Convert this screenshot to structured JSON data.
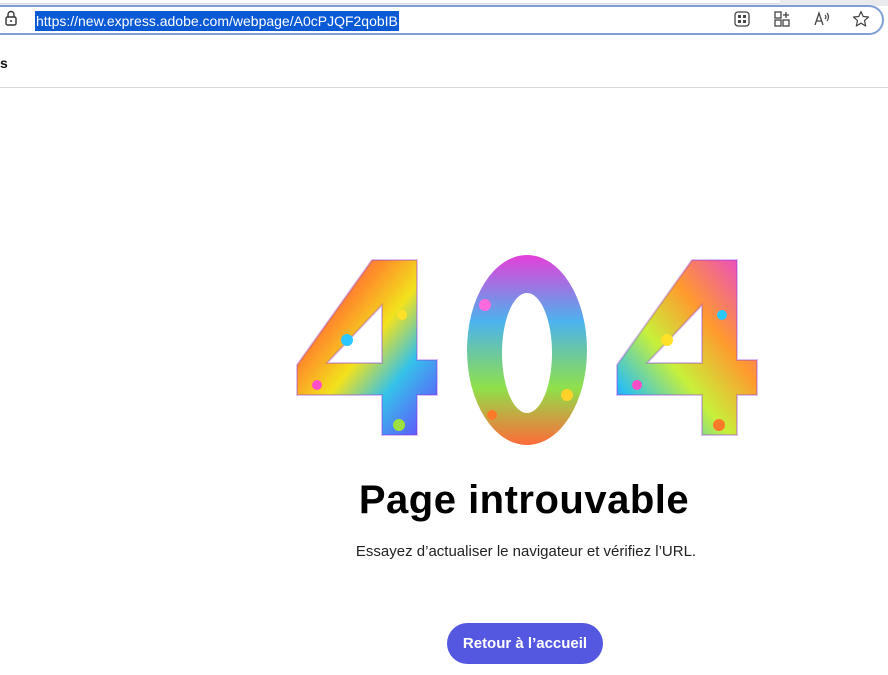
{
  "browser": {
    "url": "https://new.express.adobe.com/webpage/A0cPJQF2qobIB",
    "icons": [
      "lock-icon",
      "app-grid-icon",
      "add-tab-icon",
      "read-aloud-icon",
      "favorite-star-icon"
    ]
  },
  "subbar": {
    "text": "s"
  },
  "error_page": {
    "code": "404",
    "title": "Page introuvable",
    "message": "Essayez d’actualiser le navigateur et vérifiez l’URL.",
    "button_label": "Retour à l’accueil",
    "button_color": "#5458e0"
  }
}
